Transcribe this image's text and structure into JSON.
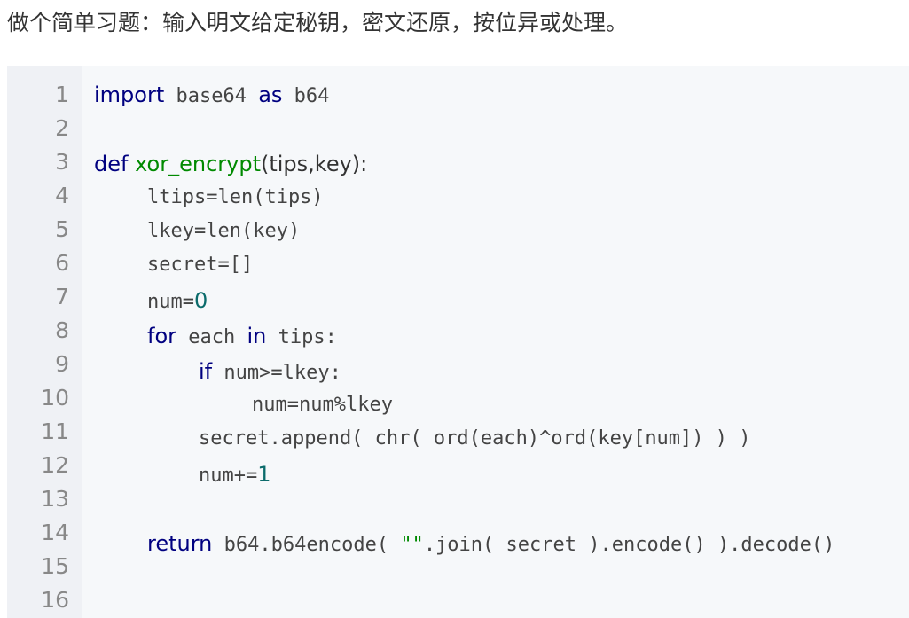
{
  "intro_text": "做个简单习题：输入明文给定秘钥，密文还原，按位异或处理。",
  "line_numbers": [
    "1",
    "2",
    "3",
    "4",
    "5",
    "6",
    "7",
    "8",
    "9",
    "10",
    "11",
    "12",
    "13",
    "14",
    "15",
    "16"
  ],
  "code": {
    "l1": {
      "kw_import": "import",
      "mod": " base64 ",
      "kw_as": "as",
      "alias": " b64"
    },
    "l3": {
      "kw_def": "def",
      "fname": " xor_encrypt",
      "params": "(tips,key):"
    },
    "l4": {
      "text": "ltips=len(tips)"
    },
    "l5": {
      "text": "lkey=len(key)"
    },
    "l6": {
      "text": "secret=[]"
    },
    "l7": {
      "var": "num=",
      "num": "0"
    },
    "l8": {
      "kw_for": "for",
      "var": " each ",
      "kw_in": "in",
      "rest": " tips:"
    },
    "l9": {
      "kw_if": "if",
      "rest": " num>=lkey:"
    },
    "l10": {
      "text": "num=num%lkey"
    },
    "l11": {
      "text": "secret.append( chr( ord(each)^ord(key[num]) ) )"
    },
    "l12": {
      "var": "num+=",
      "num": "1"
    },
    "l14": {
      "kw_return": "return",
      "pre": " b64.b64encode( ",
      "str": "\"\"",
      "post": ".join( secret ).encode() ).decode()"
    }
  },
  "colors": {
    "keyword": "#000080",
    "function_name": "#008a00",
    "number": "#0b6b6b",
    "code_bg": "#f6f8fa",
    "gutter_bg": "#eff1f5",
    "line_number": "#888888"
  }
}
